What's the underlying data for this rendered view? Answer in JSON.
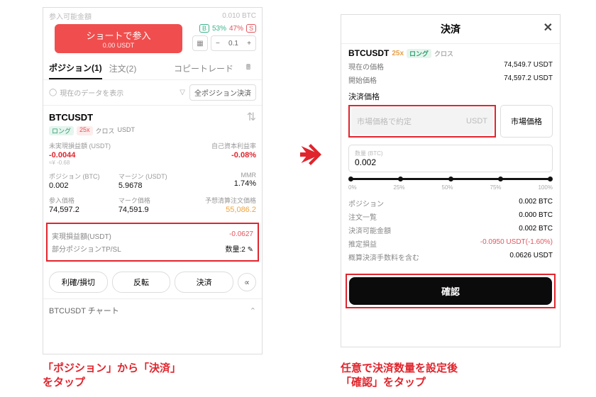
{
  "left": {
    "avail_label": "参入可能金額",
    "avail_value": "0.010 BTC",
    "short_btn": "ショートで参入",
    "short_sub": "0.00 USDT",
    "b_pct": "53%",
    "s_pct": "47%",
    "qty": "0.1",
    "tabs": {
      "pos": "ポジション(1)",
      "orders": "注文(2)",
      "copy": "コピートレード"
    },
    "show_placeholder": "現在のデータを表示",
    "close_all": "全ポジション決済",
    "symbol": "BTCUSDT",
    "long_label": "ロング",
    "lev": "25x",
    "cross": "クロス",
    "quote": "USDT",
    "upnl_label": "未実現損益額 (USDT)",
    "upnl_val": "-0.0044",
    "upnl_fiat": "≈¥ -0.68",
    "roi_label": "自己資本利益率",
    "roi_val": "-0.08%",
    "pos_btc_label": "ポジション (BTC)",
    "pos_btc": "0.002",
    "margin_label": "マージン (USDT)",
    "margin": "5.9678",
    "mmr_label": "MMR",
    "mmr": "1.74%",
    "entry_label": "参入価格",
    "entry": "74,597.2",
    "mark_label": "マーク価格",
    "mark": "74,591.9",
    "liq_label": "予想清算注文価格",
    "liq": "55,086.2",
    "realized_label": "実現損益額(USDT)",
    "realized_val": "-0.0627",
    "partial_label": "部分ポジションTP/SL",
    "partial_qty": "数量:2",
    "btn_profit": "利確/損切",
    "btn_reverse": "反転",
    "btn_close": "決済",
    "chart_label": "BTCUSDT チャート"
  },
  "right": {
    "title": "決済",
    "symbol": "BTCUSDT",
    "lev": "25x",
    "long": "ロング",
    "cross": "クロス",
    "cur_label": "現在の価格",
    "cur_val": "74,549.7 USDT",
    "open_label": "開始価格",
    "open_val": "74,597.2 USDT",
    "price_section": "決済価格",
    "price_placeholder": "市場価格で約定",
    "price_unit": "USDT",
    "market_btn": "市場価格",
    "qty_label": "数量 (BTC)",
    "qty_val": "0.002",
    "ticks": [
      "0%",
      "25%",
      "50%",
      "75%",
      "100%"
    ],
    "pos_label": "ポジション",
    "pos_val": "0.002 BTC",
    "orders_label": "注文一覧",
    "orders_val": "0.000 BTC",
    "avail_label": "決済可能金額",
    "avail_val": "0.002 BTC",
    "est_label": "推定損益",
    "est_val": "-0.0950 USDT(-1.60%)",
    "fee_label": "概算決済手数料を含む",
    "fee_val": "0.0626 USDT",
    "confirm": "確認"
  },
  "captions": {
    "left": "「ポジション」から「決済」\nをタップ",
    "right": "任意で決済数量を設定後\n「確認」をタップ"
  }
}
